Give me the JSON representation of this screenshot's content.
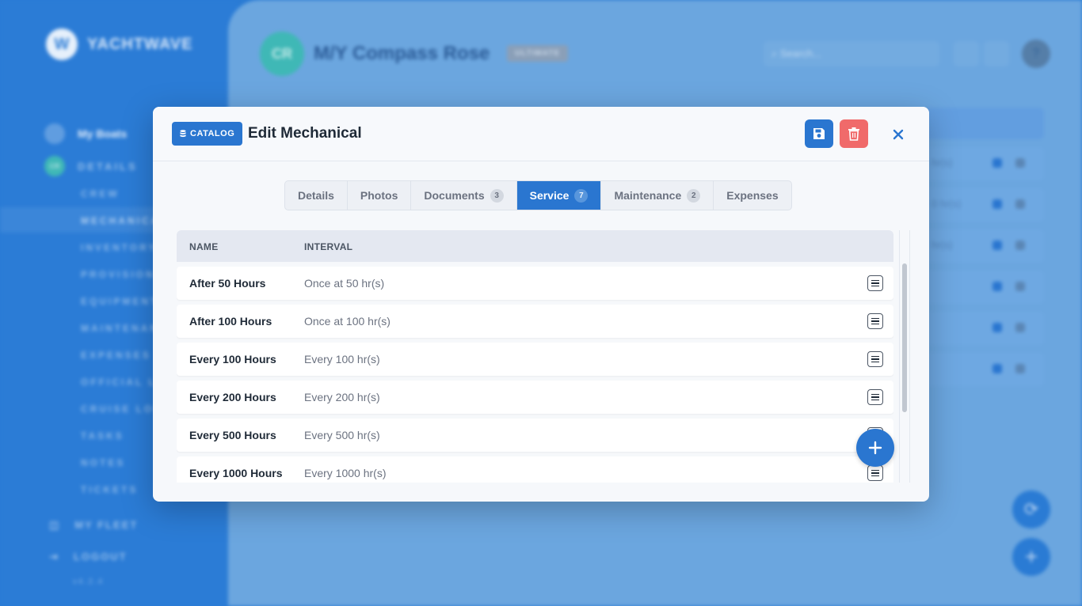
{
  "brand": {
    "name": "YACHTWAVE",
    "logo_letter": "W"
  },
  "sidebar": {
    "my_boats": "My Boats",
    "details": "DETAILS",
    "avatar_initials": "CR",
    "items": [
      "CREW",
      "MECHANICAL",
      "INVENTORY",
      "PROVISIONS",
      "EQUIPMENT",
      "MAINTENANCE",
      "EXPENSES",
      "OFFICIAL LOG",
      "CRUISE LOG",
      "TASKS",
      "NOTES",
      "TICKETS"
    ],
    "my_fleet": "MY FLEET",
    "logout": "LOGOUT",
    "version": "v4.2.4"
  },
  "header": {
    "avatar_initials": "CR",
    "vessel_name": "M/Y Compass Rose",
    "plan_badge": "ULTIMATE",
    "search_placeholder": "Search..."
  },
  "background_rows": [
    "hr(s)",
    "0 hr(s)",
    "hr(s)",
    "",
    "",
    ""
  ],
  "modal": {
    "catalog_label": "CATALOG",
    "title": "Edit Mechanical",
    "tabs": [
      {
        "label": "Details",
        "count": null
      },
      {
        "label": "Photos",
        "count": null
      },
      {
        "label": "Documents",
        "count": "3"
      },
      {
        "label": "Service",
        "count": "7"
      },
      {
        "label": "Maintenance",
        "count": "2"
      },
      {
        "label": "Expenses",
        "count": null
      }
    ],
    "active_tab": "Service",
    "table": {
      "columns": [
        "NAME",
        "INTERVAL"
      ],
      "rows": [
        {
          "name": "After 50 Hours",
          "interval": "Once at 50 hr(s)"
        },
        {
          "name": "After 100 Hours",
          "interval": "Once at 100 hr(s)"
        },
        {
          "name": "Every 100 Hours",
          "interval": "Every 100 hr(s)"
        },
        {
          "name": "Every 200 Hours",
          "interval": "Every 200 hr(s)"
        },
        {
          "name": "Every 500 Hours",
          "interval": "Every 500 hr(s)"
        },
        {
          "name": "Every 1000 Hours",
          "interval": "Every 1000 hr(s)"
        }
      ]
    }
  },
  "colors": {
    "primary": "#2a76d0",
    "danger": "#f06a6a",
    "teal": "#3fb8b6"
  }
}
